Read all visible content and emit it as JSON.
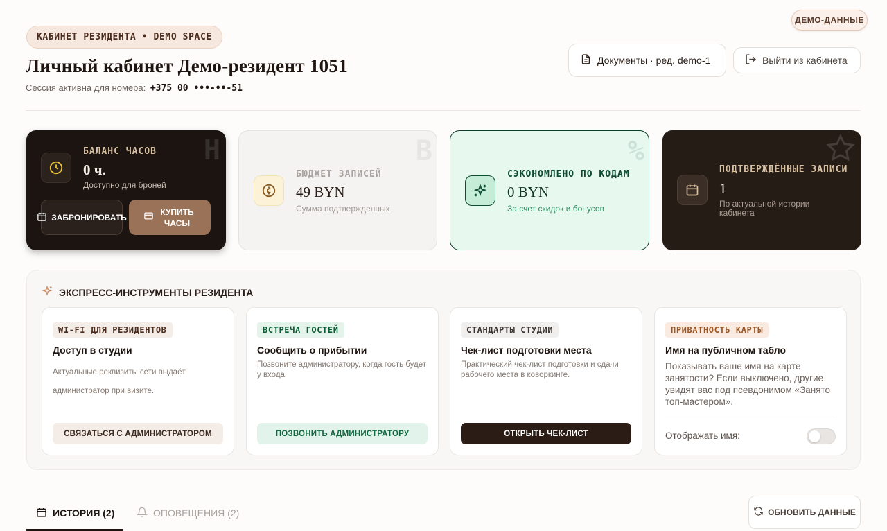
{
  "header": {
    "demo_badge": "ДЕМО-ДАННЫЕ",
    "breadcrumb": "КАБИНЕТ РЕЗИДЕНТА • DEMO SPACE",
    "title": "Личный кабинет Демо-резидент 1051",
    "session_label": "Сессия активна для номера:",
    "phone": "+375 00 •••-••-51",
    "docs_button": "Документы · ред. demo-1",
    "logout_button": "Выйти из кабинета"
  },
  "stats": {
    "balance": {
      "label": "БАЛАНС ЧАСОВ",
      "value": "0 ч.",
      "sub": "Доступно для броней",
      "watermark": "H",
      "book_button": "ЗАБРОНИРОВАТЬ",
      "buy_button": "КУПИТЬ ЧАСЫ"
    },
    "budget": {
      "label": "БЮДЖЕТ ЗАПИСЕЙ",
      "value": "49 BYN",
      "sub": "Сумма подтвержденных",
      "watermark": "B"
    },
    "saved": {
      "label": "СЭКОНОМЛЕНО ПО КОДАМ",
      "value": "0 BYN",
      "sub": "За счет скидок и бонусов",
      "watermark": "%"
    },
    "confirmed": {
      "label": "ПОДТВЕРЖДЁННЫЕ ЗАПИСИ",
      "value": "1",
      "sub": "По актуальной истории кабинета"
    }
  },
  "express": {
    "title": "ЭКСПРЕСС-ИНСТРУМЕНТЫ РЕЗИДЕНТА",
    "tools": [
      {
        "tag": "WI-FI ДЛЯ РЕЗИДЕНТОВ",
        "title": "Доступ в студии",
        "desc": "Актуальные реквизиты сети выдаёт администратор при визите.",
        "button": "СВЯЗАТЬСЯ С АДМИНИСТРАТОРОМ"
      },
      {
        "tag": "ВСТРЕЧА ГОСТЕЙ",
        "title": "Сообщить о прибытии",
        "desc": "Позвоните администратору, когда гость будет у входа.",
        "button": "ПОЗВОНИТЬ АДМИНИСТРАТОРУ"
      },
      {
        "tag": "СТАНДАРТЫ СТУДИИ",
        "title": "Чек-лист подготовки места",
        "desc": "Практический чек-лист подготовки и сдачи рабочего места в коворкинге.",
        "button": "ОТКРЫТЬ ЧЕК-ЛИСТ"
      },
      {
        "tag": "ПРИВАТНОСТЬ КАРТЫ",
        "title": "Имя на публичном табло",
        "desc": "Показывать ваше имя на карте занятости? Если выключено, другие увидят вас под псевдонимом «Занято топ-мастером».",
        "toggle_label": "Отображать имя:"
      }
    ]
  },
  "tabs": {
    "history": "ИСТОРИЯ (2)",
    "alerts": "ОПОВЕЩЕНИЯ (2)",
    "refresh": "ОБНОВИТЬ ДАННЫЕ"
  }
}
